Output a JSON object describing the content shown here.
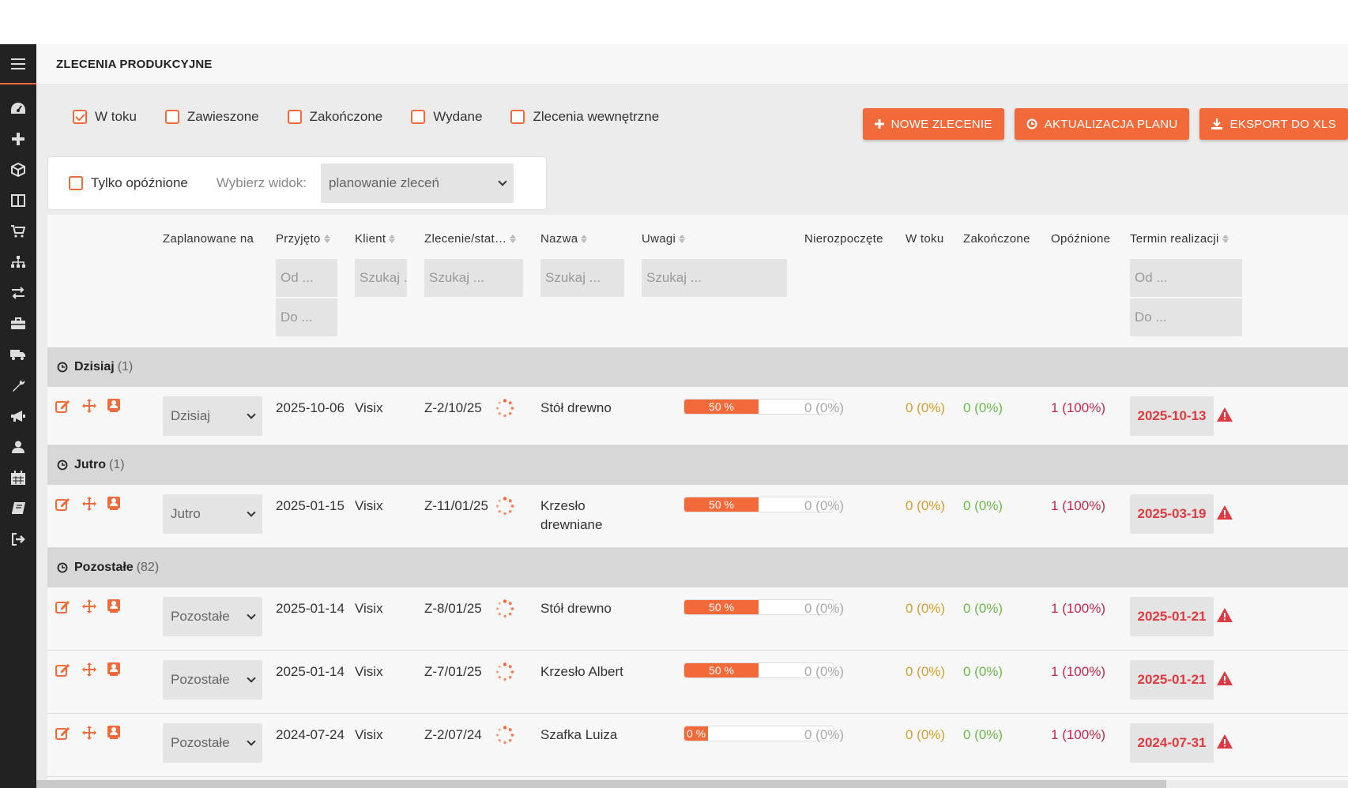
{
  "page": {
    "title": "ZLECENIA PRODUKCYJNE"
  },
  "sidebar": {
    "items": [
      "dashboard-icon",
      "plus-icon",
      "cube-icon",
      "columns-icon",
      "cart-icon",
      "sitemap-icon",
      "exchange-icon",
      "briefcase-icon",
      "truck-icon",
      "wrench-icon",
      "bullhorn-icon",
      "user-icon",
      "calendar-icon",
      "book-icon",
      "sign-out-icon"
    ]
  },
  "filters": [
    {
      "label": "W toku",
      "checked": true
    },
    {
      "label": "Zawieszone",
      "checked": false
    },
    {
      "label": "Zakończone",
      "checked": false
    },
    {
      "label": "Wydane",
      "checked": false
    },
    {
      "label": "Zlecenia wewnętrzne",
      "checked": false
    }
  ],
  "actions": {
    "new_order": "NOWE ZLECENIE",
    "update_plan": "AKTUALIZACJA PLANU",
    "export_xls": "EKSPORT DO XLS"
  },
  "view": {
    "only_late": "Tylko opóźnione",
    "choose_label": "Wybierz widok:",
    "selected": "planowanie zleceń"
  },
  "columns": {
    "planned": "Zaplanowane na",
    "accepted": "Przyjęto",
    "client": "Klient",
    "order_status": "Zlecenie/stat…",
    "name": "Nazwa",
    "notes": "Uwagi",
    "not_started": "Nierozpoczęte",
    "in_progress": "W toku",
    "finished": "Zakończone",
    "delayed": "Opóźnione",
    "deadline": "Termin realizacji"
  },
  "placeholders": {
    "from": "Od ...",
    "to": "Do ...",
    "search_short": "Szukaj .",
    "search": "Szukaj ..."
  },
  "groups": [
    {
      "name": "Dzisiaj",
      "count": "(1)"
    },
    {
      "name": "Jutro",
      "count": "(1)"
    },
    {
      "name": "Pozostałe",
      "count": "(82)"
    }
  ],
  "rows": [
    {
      "plan": "Dzisiaj",
      "accepted": "2025-10-06",
      "client": "Visix",
      "order": "Z-2/10/25",
      "name": "Stół drewno",
      "progress": "50 %",
      "progress_pct": 50,
      "not_started": "0 (0%)",
      "in_progress": "0 (0%)",
      "finished": "0 (0%)",
      "delayed": "1 (100%)",
      "deadline": "2025-10-13"
    },
    {
      "plan": "Jutro",
      "accepted": "2025-01-15",
      "client": "Visix",
      "order": "Z-11/01/25",
      "name": "Krzesło drewniane",
      "progress": "50 %",
      "progress_pct": 50,
      "not_started": "0 (0%)",
      "in_progress": "0 (0%)",
      "finished": "0 (0%)",
      "delayed": "1 (100%)",
      "deadline": "2025-03-19"
    },
    {
      "plan": "Pozostałe",
      "accepted": "2025-01-14",
      "client": "Visix",
      "order": "Z-8/01/25",
      "name": "Stół drewno",
      "progress": "50 %",
      "progress_pct": 50,
      "not_started": "0 (0%)",
      "in_progress": "0 (0%)",
      "finished": "0 (0%)",
      "delayed": "1 (100%)",
      "deadline": "2025-01-21"
    },
    {
      "plan": "Pozostałe",
      "accepted": "2025-01-14",
      "client": "Visix",
      "order": "Z-7/01/25",
      "name": "Krzesło Albert",
      "progress": "50 %",
      "progress_pct": 50,
      "not_started": "0 (0%)",
      "in_progress": "0 (0%)",
      "finished": "0 (0%)",
      "delayed": "1 (100%)",
      "deadline": "2025-01-21"
    },
    {
      "plan": "Pozostałe",
      "accepted": "2024-07-24",
      "client": "Visix",
      "order": "Z-2/07/24",
      "name": "Szafka Luiza",
      "progress": "0 %",
      "progress_pct": 0,
      "not_started": "0 (0%)",
      "in_progress": "0 (0%)",
      "finished": "0 (0%)",
      "delayed": "1 (100%)",
      "deadline": "2024-07-31"
    }
  ],
  "colors": {
    "accent": "#f26a3a",
    "sidebar": "#222222",
    "deadline": "#e03a40"
  }
}
